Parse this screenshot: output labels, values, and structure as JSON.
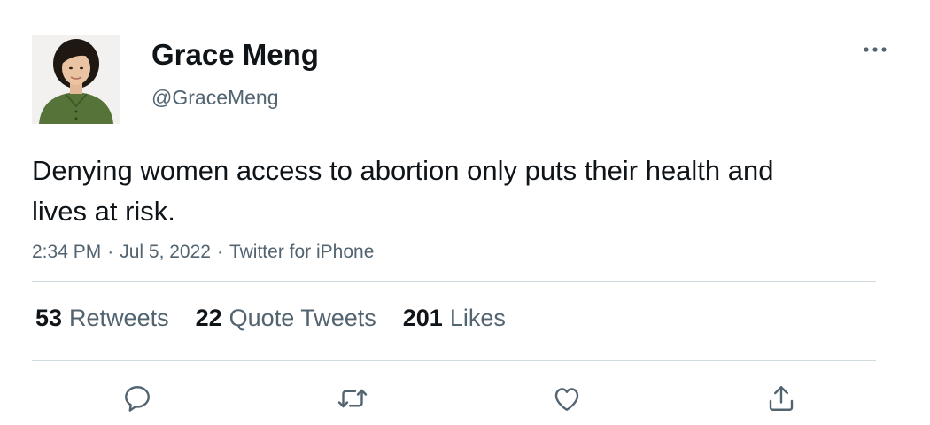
{
  "user": {
    "display_name": "Grace Meng",
    "handle": "@GraceMeng",
    "avatar_icon": "profile-photo"
  },
  "tweet": {
    "text": "Denying women access to abortion only puts their health and lives at risk.",
    "time": "2:34 PM",
    "date": "Jul 5, 2022",
    "source": "Twitter for iPhone",
    "separator": "·"
  },
  "stats": {
    "retweets": {
      "count": "53",
      "label": "Retweets"
    },
    "quote_tweets": {
      "count": "22",
      "label": "Quote Tweets"
    },
    "likes": {
      "count": "201",
      "label": "Likes"
    }
  },
  "actions": [
    {
      "name": "reply",
      "icon": "reply-icon"
    },
    {
      "name": "retweet",
      "icon": "retweet-icon"
    },
    {
      "name": "like",
      "icon": "heart-icon"
    },
    {
      "name": "share",
      "icon": "share-icon"
    }
  ],
  "colors": {
    "text_primary": "#0f1419",
    "text_secondary": "#536471",
    "divider": "#cfd9de"
  }
}
